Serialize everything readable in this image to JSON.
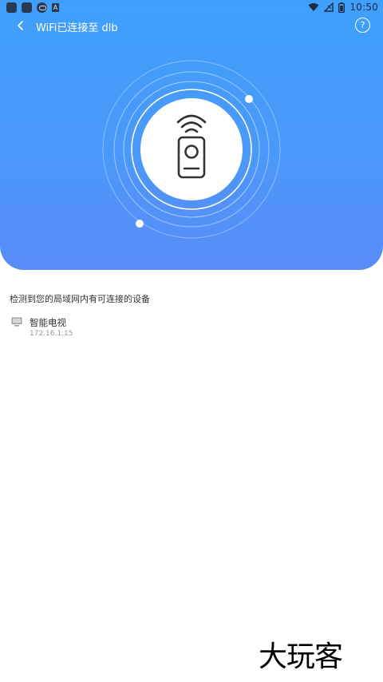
{
  "status_bar": {
    "time": "10:50",
    "icons": [
      "app-square-icon",
      "app-square-icon",
      "cloud-icon",
      "a-icon",
      "wifi-icon",
      "signal-off-icon",
      "battery-icon"
    ]
  },
  "header": {
    "title": "WiFi已连接至 dlb",
    "help_label": "?"
  },
  "colors": {
    "gradient_top": "#3fa0fb",
    "gradient_bottom": "#5a8cf8",
    "text_primary": "#333333",
    "text_secondary": "#999999"
  },
  "devices_section": {
    "label": "检测到您的局域网内有可连接的设备",
    "devices": [
      {
        "name": "智能电视",
        "ip": "172.16.1.15",
        "icon": "tv-icon"
      }
    ]
  },
  "watermark": "大玩客"
}
